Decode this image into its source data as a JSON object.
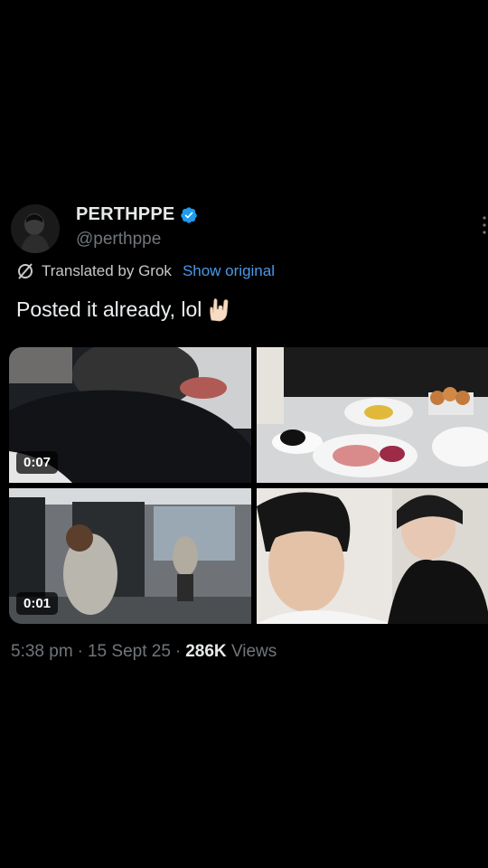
{
  "author": {
    "display_name": "PERTHPPE",
    "handle": "@perthppe",
    "verified_icon": "verified-badge-icon",
    "verified_color": "#1d9bf0"
  },
  "translation": {
    "icon": "grok-icon",
    "label": "Translated by Grok",
    "show_original": "Show original",
    "link_color": "#4a99e9"
  },
  "post": {
    "text": "Posted it already, lol",
    "emoji": "rock-on-hand-emoji"
  },
  "media": [
    {
      "kind": "video",
      "duration": "0:07"
    },
    {
      "kind": "image"
    },
    {
      "kind": "video",
      "duration": "0:01"
    },
    {
      "kind": "image"
    }
  ],
  "meta": {
    "time": "5:38 pm",
    "date": "15 Sept 25",
    "separator": "·",
    "views_count": "286K",
    "views_label": "Views"
  }
}
